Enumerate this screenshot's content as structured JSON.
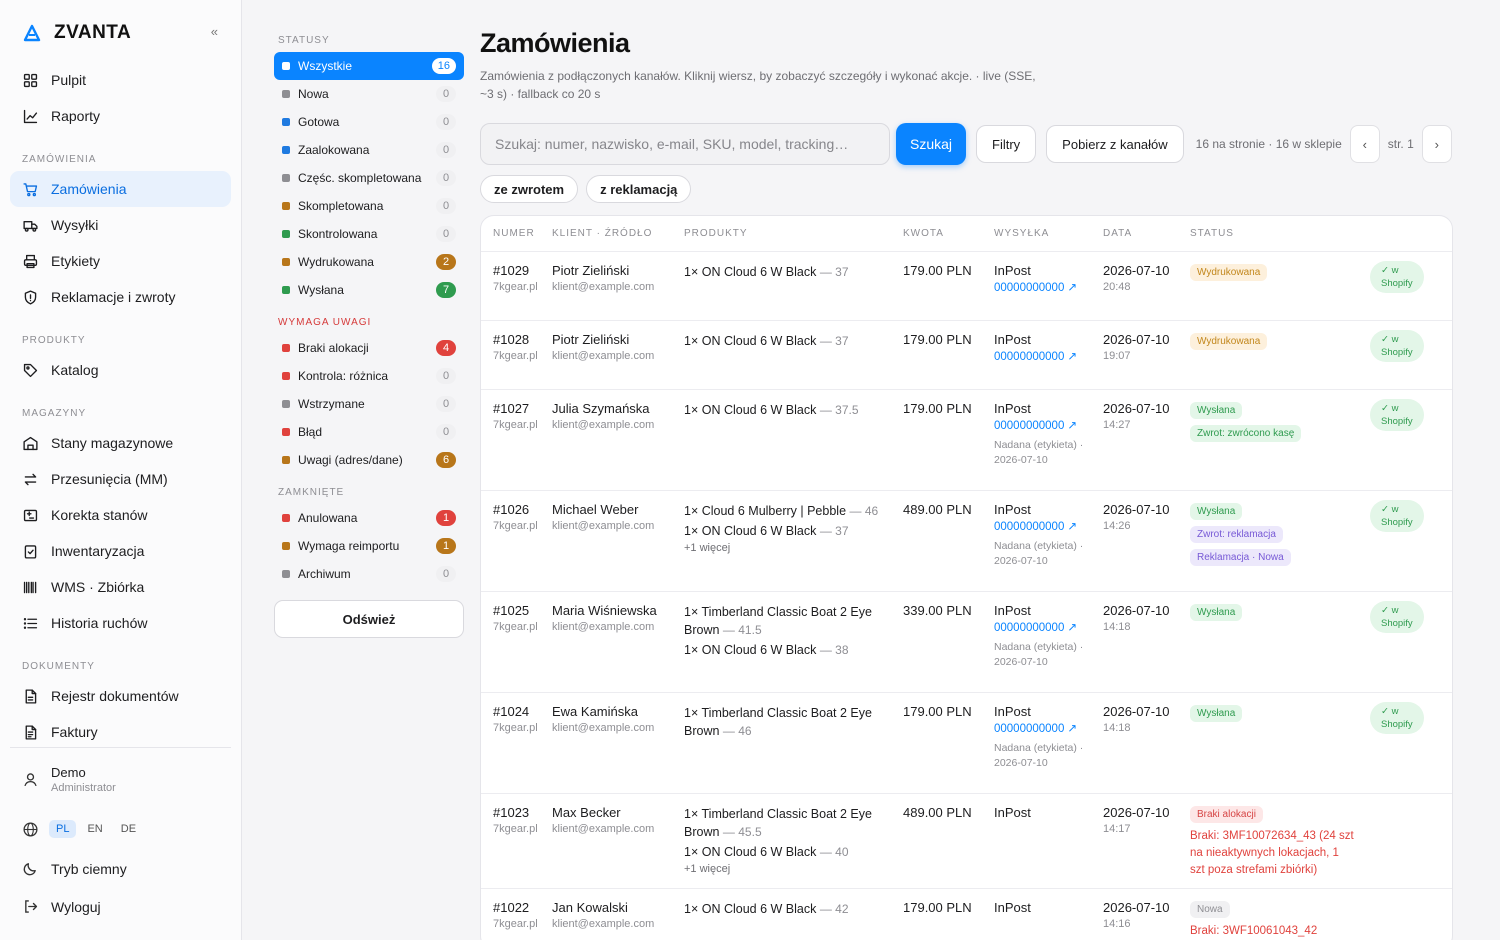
{
  "brand": {
    "logo_text": "ZVANTA",
    "collapse": "«"
  },
  "sidebar": {
    "top_items": [
      {
        "label": "Pulpit"
      },
      {
        "label": "Raporty"
      }
    ],
    "sections": [
      {
        "title": "ZAMÓWIENIA",
        "items": [
          {
            "label": "Zamówienia",
            "active": true
          },
          {
            "label": "Wysyłki"
          },
          {
            "label": "Etykiety"
          },
          {
            "label": "Reklamacje i zwroty"
          }
        ]
      },
      {
        "title": "PRODUKTY",
        "items": [
          {
            "label": "Katalog"
          }
        ]
      },
      {
        "title": "MAGAZYNY",
        "items": [
          {
            "label": "Stany magazynowe"
          },
          {
            "label": "Przesunięcia (MM)"
          },
          {
            "label": "Korekta stanów"
          },
          {
            "label": "Inwentaryzacja"
          },
          {
            "label": "WMS · Zbiórka"
          },
          {
            "label": "Historia ruchów"
          }
        ]
      },
      {
        "title": "DOKUMENTY",
        "items": [
          {
            "label": "Rejestr dokumentów"
          },
          {
            "label": "Faktury"
          }
        ]
      }
    ],
    "user": {
      "name": "Demo",
      "role": "Administrator"
    },
    "languages": [
      "PL",
      "EN",
      "DE"
    ],
    "active_language": "PL",
    "dark_mode": "Tryb ciemny",
    "logout": "Wyloguj"
  },
  "statuses": {
    "sections": [
      {
        "title": "STATUSY",
        "warn": false,
        "items": [
          {
            "label": "Wszystkie",
            "count": "16",
            "color": "#ffffff",
            "active": true
          },
          {
            "label": "Nowa",
            "count": "0",
            "color": "#8e8e93"
          },
          {
            "label": "Gotowa",
            "count": "0",
            "color": "#1f7ae0"
          },
          {
            "label": "Zaalokowana",
            "count": "0",
            "color": "#1f7ae0"
          },
          {
            "label": "Częśc. skompletowana",
            "count": "0",
            "color": "#8e8e93"
          },
          {
            "label": "Skompletowana",
            "count": "0",
            "color": "#b8761a"
          },
          {
            "label": "Skontrolowana",
            "count": "0",
            "color": "#2f9b4f"
          },
          {
            "label": "Wydrukowana",
            "count": "2",
            "color": "#b8761a",
            "badge": "#b8761a"
          },
          {
            "label": "Wysłana",
            "count": "7",
            "color": "#2f9b4f",
            "badge": "#2f9b4f"
          }
        ]
      },
      {
        "title": "WYMAGA UWAGI",
        "warn": true,
        "items": [
          {
            "label": "Braki alokacji",
            "count": "4",
            "color": "#e0423d",
            "badge": "#e0423d"
          },
          {
            "label": "Kontrola: różnica",
            "count": "0",
            "color": "#e0423d"
          },
          {
            "label": "Wstrzymane",
            "count": "0",
            "color": "#8e8e93"
          },
          {
            "label": "Błąd",
            "count": "0",
            "color": "#e0423d"
          },
          {
            "label": "Uwagi (adres/dane)",
            "count": "6",
            "color": "#b8761a",
            "badge": "#b8761a"
          }
        ]
      },
      {
        "title": "ZAMKNIĘTE",
        "warn": false,
        "items": [
          {
            "label": "Anulowana",
            "count": "1",
            "color": "#e0423d",
            "badge": "#e0423d"
          },
          {
            "label": "Wymaga reimportu",
            "count": "1",
            "color": "#b8761a",
            "badge": "#b8761a"
          },
          {
            "label": "Archiwum",
            "count": "0",
            "color": "#8e8e93"
          }
        ]
      }
    ],
    "refresh_label": "Odśwież"
  },
  "main": {
    "title": "Zamówienia",
    "subtitle": "Zamówienia z podłączonych kanałów. Kliknij wiersz, by zobaczyć szczegóły i wykonać akcje. · live (SSE, ~3 s) · fallback co 20 s",
    "search_placeholder": "Szukaj: numer, nazwisko, e-mail, SKU, model, tracking…",
    "search_button": "Szukaj",
    "filters_button": "Filtry",
    "fetch_button": "Pobierz z kanałów",
    "pager_info": "16 na stronie · 16 w sklepie",
    "prev": "‹",
    "page_label": "str. 1",
    "next": "›",
    "chips": [
      "ze zwrotem",
      "z reklamacją"
    ],
    "columns": [
      "NUMER",
      "KLIENT · ŹRÓDŁO",
      "PRODUKTY",
      "KWOTA",
      "WYSYŁKA",
      "DATA",
      "STATUS"
    ]
  },
  "orders": [
    {
      "number": "#1029",
      "source": "7kgear.pl",
      "client": "Piotr Zieliński",
      "email": "klient@example.com",
      "products": [
        {
          "name": "1× ON Cloud 6 W Black",
          "size": "— 37"
        }
      ],
      "more": "",
      "amount": "179.00 PLN",
      "carrier": "InPost",
      "tracking": "00000000000 ↗",
      "ship_note": "",
      "date": "2026-07-10",
      "time": "20:48",
      "badges": [
        {
          "text": "Wydrukowana",
          "kind": "b-printed"
        }
      ],
      "error": "",
      "shopify": "w Shopify"
    },
    {
      "number": "#1028",
      "source": "7kgear.pl",
      "client": "Piotr Zieliński",
      "email": "klient@example.com",
      "products": [
        {
          "name": "1× ON Cloud 6 W Black",
          "size": "— 37"
        }
      ],
      "more": "",
      "amount": "179.00 PLN",
      "carrier": "InPost",
      "tracking": "00000000000 ↗",
      "ship_note": "",
      "date": "2026-07-10",
      "time": "19:07",
      "badges": [
        {
          "text": "Wydrukowana",
          "kind": "b-printed"
        }
      ],
      "error": "",
      "shopify": "w Shopify"
    },
    {
      "number": "#1027",
      "source": "7kgear.pl",
      "client": "Julia Szymańska",
      "email": "klient@example.com",
      "products": [
        {
          "name": "1× ON Cloud 6 W Black",
          "size": "— 37.5"
        }
      ],
      "more": "",
      "amount": "179.00 PLN",
      "carrier": "InPost",
      "tracking": "00000000000 ↗",
      "ship_note": "Nadana (etykieta) · 2026-07-10",
      "date": "2026-07-10",
      "time": "14:27",
      "badges": [
        {
          "text": "Wysłana",
          "kind": "b-sent"
        },
        {
          "text": "Zwrot: zwrócono kasę",
          "kind": "b-return"
        }
      ],
      "error": "",
      "shopify": "w Shopify"
    },
    {
      "number": "#1026",
      "source": "7kgear.pl",
      "client": "Michael Weber",
      "email": "klient@example.com",
      "products": [
        {
          "name": "1× Cloud 6 Mulberry | Pebble",
          "size": "— 46"
        },
        {
          "name": "1× ON Cloud 6 W Black",
          "size": "— 37"
        }
      ],
      "more": "+1 więcej",
      "amount": "489.00 PLN",
      "carrier": "InPost",
      "tracking": "00000000000 ↗",
      "ship_note": "Nadana (etykieta) · 2026-07-10",
      "date": "2026-07-10",
      "time": "14:26",
      "badges": [
        {
          "text": "Wysłana",
          "kind": "b-sent"
        },
        {
          "text": "Zwrot: reklamacja",
          "kind": "b-purple"
        },
        {
          "text": "Reklamacja · Nowa",
          "kind": "b-purple"
        }
      ],
      "error": "",
      "shopify": "w Shopify"
    },
    {
      "number": "#1025",
      "source": "7kgear.pl",
      "client": "Maria Wiśniewska",
      "email": "klient@example.com",
      "products": [
        {
          "name": "1× Timberland Classic Boat 2 Eye Brown",
          "size": "— 41.5"
        },
        {
          "name": "1× ON Cloud 6 W Black",
          "size": "— 38"
        }
      ],
      "more": "",
      "amount": "339.00 PLN",
      "carrier": "InPost",
      "tracking": "00000000000 ↗",
      "ship_note": "Nadana (etykieta) · 2026-07-10",
      "date": "2026-07-10",
      "time": "14:18",
      "badges": [
        {
          "text": "Wysłana",
          "kind": "b-sent"
        }
      ],
      "error": "",
      "shopify": "w Shopify"
    },
    {
      "number": "#1024",
      "source": "7kgear.pl",
      "client": "Ewa Kamińska",
      "email": "klient@example.com",
      "products": [
        {
          "name": "1× Timberland Classic Boat 2 Eye Brown",
          "size": "— 46"
        }
      ],
      "more": "",
      "amount": "179.00 PLN",
      "carrier": "InPost",
      "tracking": "00000000000 ↗",
      "ship_note": "Nadana (etykieta) · 2026-07-10",
      "date": "2026-07-10",
      "time": "14:18",
      "badges": [
        {
          "text": "Wysłana",
          "kind": "b-sent"
        }
      ],
      "error": "",
      "shopify": "w Shopify"
    },
    {
      "number": "#1023",
      "source": "7kgear.pl",
      "client": "Max Becker",
      "email": "klient@example.com",
      "products": [
        {
          "name": "1× Timberland Classic Boat 2 Eye Brown",
          "size": "— 45.5"
        },
        {
          "name": "1× ON Cloud 6 W Black",
          "size": "— 40"
        }
      ],
      "more": "+1 więcej",
      "amount": "489.00 PLN",
      "carrier": "InPost",
      "tracking": "",
      "ship_note": "",
      "date": "2026-07-10",
      "time": "14:17",
      "badges": [
        {
          "text": "Braki alokacji",
          "kind": "b-red"
        }
      ],
      "error": "Braki: 3MF10072634_43 (24 szt na nieaktywnych lokacjach, 1 szt poza strefami zbiórki)",
      "shopify": ""
    },
    {
      "number": "#1022",
      "source": "7kgear.pl",
      "client": "Jan Kowalski",
      "email": "klient@example.com",
      "products": [
        {
          "name": "1× ON Cloud 6 W Black",
          "size": "— 42"
        }
      ],
      "more": "",
      "amount": "179.00 PLN",
      "carrier": "InPost",
      "tracking": "",
      "ship_note": "",
      "date": "2026-07-10",
      "time": "14:16",
      "badges": [
        {
          "text": "Nowa",
          "kind": "b-grey"
        }
      ],
      "error": "Braki: 3WF10061043_42",
      "shopify": ""
    }
  ]
}
